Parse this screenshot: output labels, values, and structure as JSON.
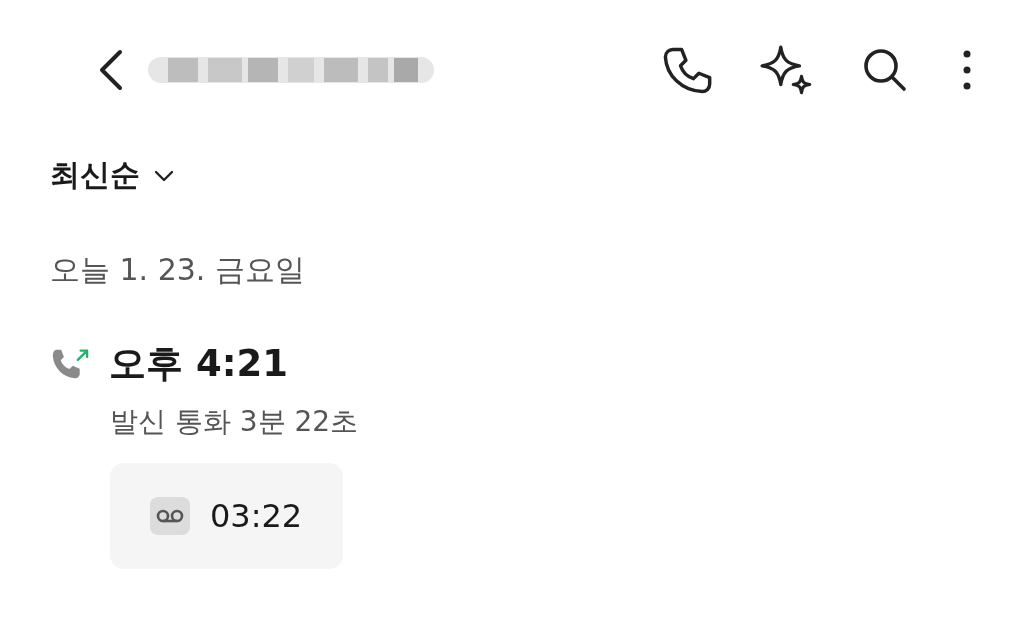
{
  "sort": {
    "label": "최신순"
  },
  "groups": [
    {
      "date": "오늘 1. 23. 금요일",
      "calls": [
        {
          "kind": "outgoing",
          "time": "오후 4:21",
          "detail": "발신 통화 3분 22초",
          "recording": {
            "duration": "03:22"
          }
        }
      ]
    }
  ]
}
